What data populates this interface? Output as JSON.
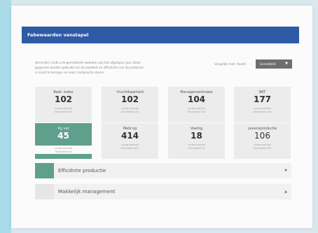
{
  "header": {
    "title": "Fabewaarden vanstapel"
  },
  "intro": {
    "lines": [
      "Hieronder vindt u de gemiddelde waarden van het afgelopen jaar. Deze",
      "gegevens worden gebruikt om de kwaliteit en efficiëntie van de productie",
      "in kaart te brengen en waar nodig bij te sturen."
    ]
  },
  "filter": {
    "label": "Vergelijk met: Hoofd",
    "selected": "Gemiddeld",
    "chevron": "▼"
  },
  "tiles": [
    {
      "label": "Bedr. index",
      "value": "102",
      "note": [
        "vorige periode",
        "Gemiddeld 100"
      ],
      "highlight": false
    },
    {
      "label": "Vruchtbaarheid",
      "value": "102",
      "note": [
        "vorige periode",
        "Gemiddeld 100"
      ],
      "highlight": false
    },
    {
      "label": "Managementindex",
      "value": "104",
      "note": [
        "vorige periode",
        "Gemiddeld 100"
      ],
      "highlight": false
    },
    {
      "label": "BKT",
      "value": "177",
      "note": [
        "vorige periode",
        "Gemiddeld 180"
      ],
      "highlight": false
    },
    {
      "label": "Kg vet",
      "value": "45",
      "note": [
        "vorige periode",
        "Gemiddeld 44"
      ],
      "highlight": true
    },
    {
      "label": "Melk kg",
      "value": "414",
      "note": [
        "vorige periode",
        "Gemiddeld 400"
      ],
      "highlight": false
    },
    {
      "label": "Voerkg",
      "value": "18",
      "note": [
        "vorige periode",
        "Gemiddeld 18"
      ],
      "highlight": false
    },
    {
      "label": "Levensproductie",
      "value": "106",
      "note": [
        "vorige periode",
        "Gemiddeld 100"
      ],
      "highlight": false
    }
  ],
  "accordions": [
    {
      "label": "Efficiënte productie",
      "color": "#5fa08c",
      "chevron": "▼"
    },
    {
      "label": "Makkelijk management",
      "color": "#e6e6e6",
      "chevron": "▲"
    }
  ],
  "colors": {
    "accent": "#2f5aa5",
    "highlight": "#5fa08c"
  }
}
